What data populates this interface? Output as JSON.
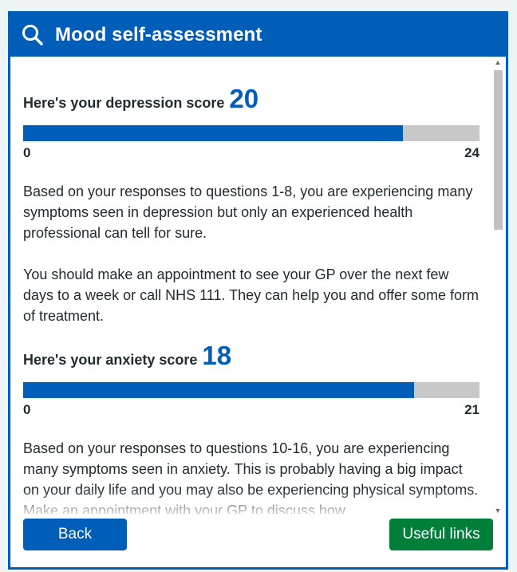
{
  "header": {
    "title": "Mood self-assessment",
    "icon": "search-icon"
  },
  "depression": {
    "label": "Here's your depression score",
    "score": "20",
    "min": "0",
    "max": "24",
    "fill_fraction": 0.833,
    "para1": "Based on your responses to questions 1-8, you are experiencing many symptoms seen in depression but only an experienced health professional can tell for sure.",
    "para2": "You should make an appointment to see your GP over the next few days to a week or call NHS 111. They can help you and offer some form of treatment."
  },
  "anxiety": {
    "label": "Here's your anxiety score",
    "score": "18",
    "min": "0",
    "max": "21",
    "fill_fraction": 0.857,
    "para1": "Based on your responses to questions 10-16, you are experiencing many symptoms seen in anxiety. This is probably having a big impact on your daily life and you may also be experiencing physical symptoms. Make an appointment with your GP to discuss how"
  },
  "buttons": {
    "back": "Back",
    "useful_links": "Useful links"
  },
  "colors": {
    "primary": "#005eb8",
    "secondary": "#007f3b",
    "track": "#c8c8c8"
  }
}
